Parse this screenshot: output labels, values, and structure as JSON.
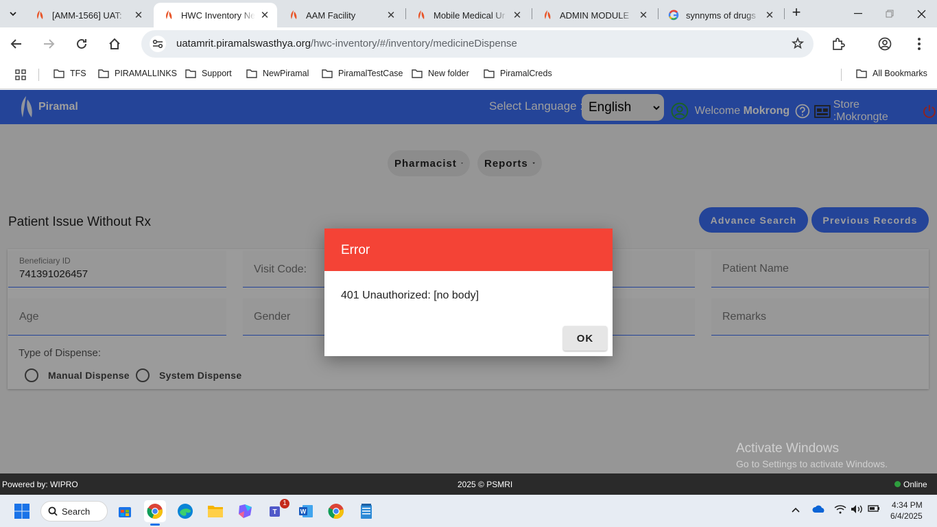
{
  "browser": {
    "tabs": [
      {
        "title": "[AMM-1566] UAT:",
        "favicon": "piramal-logo-icon",
        "active": false
      },
      {
        "title": "HWC Inventory Ne",
        "favicon": "piramal-logo-icon",
        "active": true
      },
      {
        "title": "AAM Facility",
        "favicon": "piramal-logo-icon",
        "active": false
      },
      {
        "title": "Mobile Medical Ur",
        "favicon": "piramal-logo-icon",
        "active": false
      },
      {
        "title": "ADMIN MODULE",
        "favicon": "piramal-logo-icon",
        "active": false
      },
      {
        "title": "synnyms of drugs",
        "favicon": "google-icon",
        "active": false
      }
    ],
    "url_domain": "uatamrit.piramalswasthya.org",
    "url_path": "/hwc-inventory/#/inventory/medicineDispense",
    "bookmarks": [
      "TFS",
      "PIRAMALLINKS",
      "Support",
      "NewPiramal",
      "PiramalTestCase",
      "New folder",
      "PiramalCreds"
    ],
    "all_bookmarks": "All Bookmarks"
  },
  "header": {
    "brand": "Piramal",
    "select_language_label": "Select Language :",
    "language_value": "English",
    "welcome_prefix": "Welcome",
    "welcome_user": "Mokrong",
    "store_label": "Store :Mokrongte"
  },
  "nav": {
    "pharmacist": "Pharmacist",
    "reports": "Reports"
  },
  "page": {
    "title": "Patient Issue Without Rx",
    "advance_search": "Advance Search",
    "previous_records": "Previous Records"
  },
  "form": {
    "beneficiary_id_label": "Beneficiary ID",
    "beneficiary_id_value": "741391026457",
    "visit_code_label": "Visit Code:",
    "patient_name_label": "Patient Name",
    "age_label": "Age",
    "gender_label": "Gender",
    "remarks_label": "Remarks",
    "type_of_dispense_label": "Type of Dispense:",
    "manual_dispense": "Manual Dispense",
    "system_dispense": "System Dispense"
  },
  "dialog": {
    "title": "Error",
    "message": "401 Unauthorized: [no body]",
    "ok": "OK"
  },
  "footer": {
    "powered_by": "Powered by: WIPRO",
    "copyright": "2025 © PSMRI",
    "status": "Online"
  },
  "watermark": {
    "line1": "Activate Windows",
    "line2": "Go to Settings to activate Windows."
  },
  "taskbar": {
    "search": "Search",
    "teams_badge": "1",
    "time": "4:34 PM",
    "date": "6/4/2025"
  },
  "colors": {
    "header_blue": "#3b6ef5",
    "error_red": "#f44336",
    "online_green": "#2e9e3e"
  }
}
